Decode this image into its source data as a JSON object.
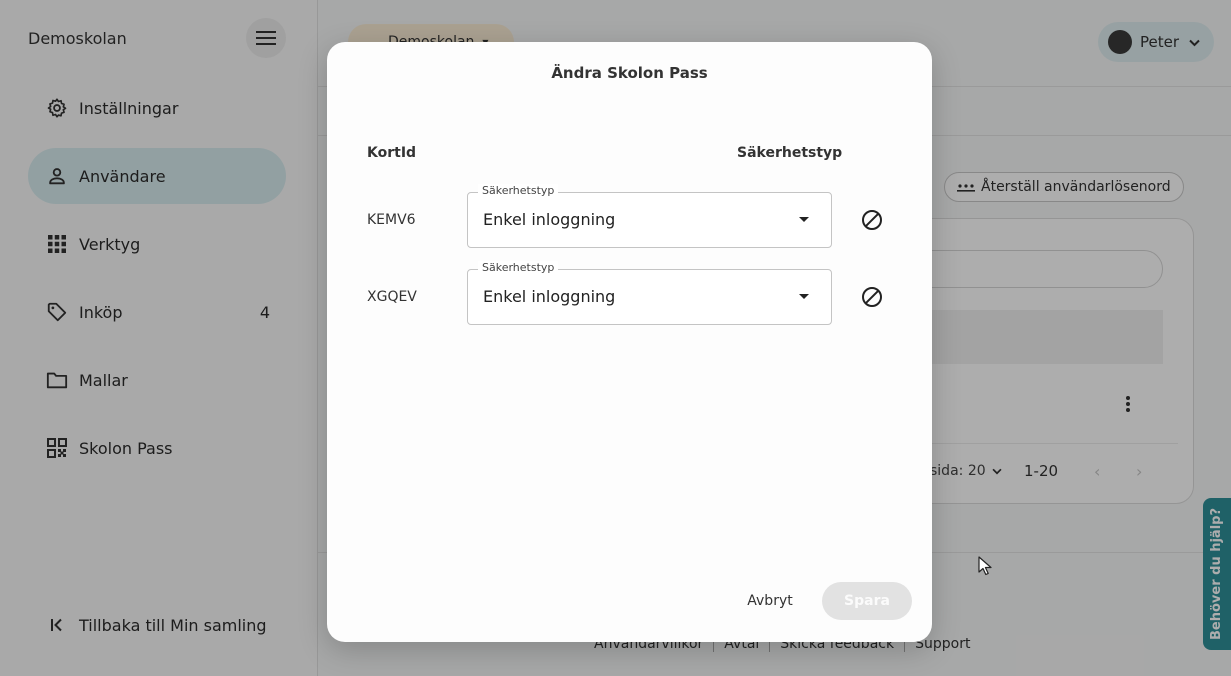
{
  "sidebar": {
    "school_name": "Demoskolan",
    "items": [
      {
        "label": "Inställningar",
        "icon": "gear-icon"
      },
      {
        "label": "Användare",
        "icon": "person-icon",
        "active": true
      },
      {
        "label": "Verktyg",
        "icon": "grid-icon"
      },
      {
        "label": "Inköp",
        "icon": "tag-icon",
        "count": "4"
      },
      {
        "label": "Mallar",
        "icon": "folder-icon"
      },
      {
        "label": "Skolon Pass",
        "icon": "qr-code-icon"
      }
    ],
    "back_label": "Tillbaka till Min samling"
  },
  "header": {
    "school_chip": "Demoskolan",
    "user_name": "Peter"
  },
  "background": {
    "reset_password_label": "Återställ användarlösenord",
    "rows_per_page": "sida: 20",
    "range": "1-20"
  },
  "footer": {
    "links": [
      "Användarvillkor",
      "Avtal",
      "Skicka feedback",
      "Support"
    ]
  },
  "help_tab": "Behöver du hjälp?",
  "dialog": {
    "title": "Ändra Skolon Pass",
    "col_card_id": "KortId",
    "col_security_type": "Säkerhetstyp",
    "rows": [
      {
        "card_id": "KEMV6",
        "field_label": "Säkerhetstyp",
        "value": "Enkel inloggning"
      },
      {
        "card_id": "XGQEV",
        "field_label": "Säkerhetstyp",
        "value": "Enkel inloggning"
      }
    ],
    "cancel_label": "Avbryt",
    "save_label": "Spara"
  },
  "colors": {
    "accent_teal": "#2f8f98",
    "active_nav_bg": "#d8ecef",
    "school_chip_bg": "#fbeed6",
    "disabled_button_bg": "#e2e2e2"
  }
}
